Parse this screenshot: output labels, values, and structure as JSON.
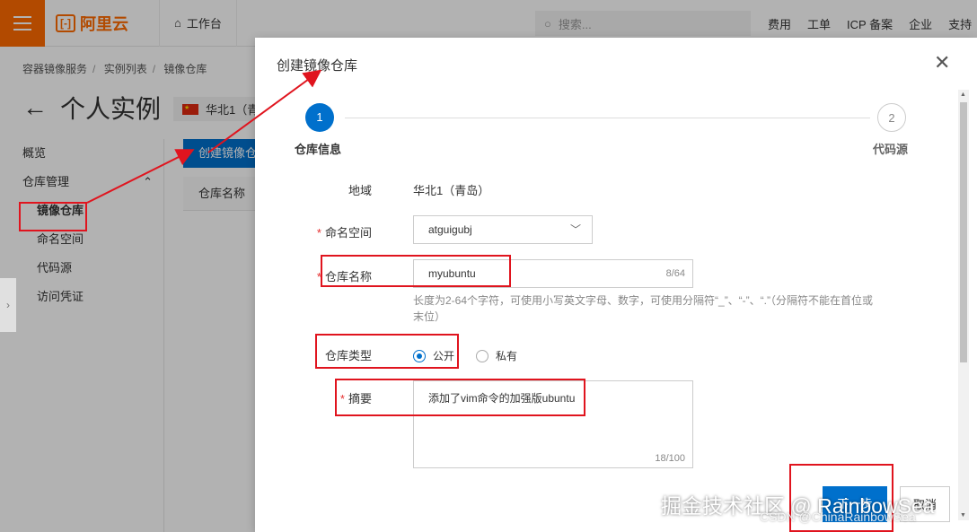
{
  "topbar": {
    "logo_mark": "[-]",
    "logo_text": "阿里云",
    "workbench": "工作台",
    "search_placeholder": "搜索...",
    "nav": [
      "费用",
      "工单",
      "ICP 备案",
      "企业",
      "支持"
    ]
  },
  "breadcrumb": [
    "容器镜像服务",
    "实例列表",
    "镜像仓库"
  ],
  "page_title": "个人实例",
  "region": "华北1（青",
  "sidebar": {
    "overview": "概览",
    "repo_mgmt": "仓库管理",
    "items": [
      "镜像仓库",
      "命名空间",
      "代码源",
      "访问凭证"
    ]
  },
  "main": {
    "create_button": "创建镜像仓库",
    "col_repo_name": "仓库名称"
  },
  "modal": {
    "title": "创建镜像仓库",
    "steps": [
      {
        "num": "1",
        "label": "仓库信息"
      },
      {
        "num": "2",
        "label": "代码源"
      }
    ],
    "region_label": "地域",
    "region_value": "华北1（青岛）",
    "namespace_label": "命名空间",
    "namespace_value": "atguigubj",
    "repo_name_label": "仓库名称",
    "repo_name_value": "myubuntu",
    "repo_name_count": "8/64",
    "repo_name_hint": "长度为2-64个字符，可使用小写英文字母、数字，可使用分隔符“_”、“-”、“.”（分隔符不能在首位或末位）",
    "repo_type_label": "仓库类型",
    "repo_type_options": [
      "公开",
      "私有"
    ],
    "repo_type_selected": "公开",
    "summary_label": "摘要",
    "summary_value": "添加了vim命令的加强版ubuntu",
    "summary_count": "18/100",
    "next_button": "下一步",
    "cancel_button": "取消"
  },
  "watermark": "掘金技术社区 @ RainbowSea",
  "watermark2": "CSDN @ChinaRainbowSea",
  "colors": {
    "brand": "#ff6a00",
    "primary": "#0070cc",
    "annotation": "#e0141e"
  }
}
